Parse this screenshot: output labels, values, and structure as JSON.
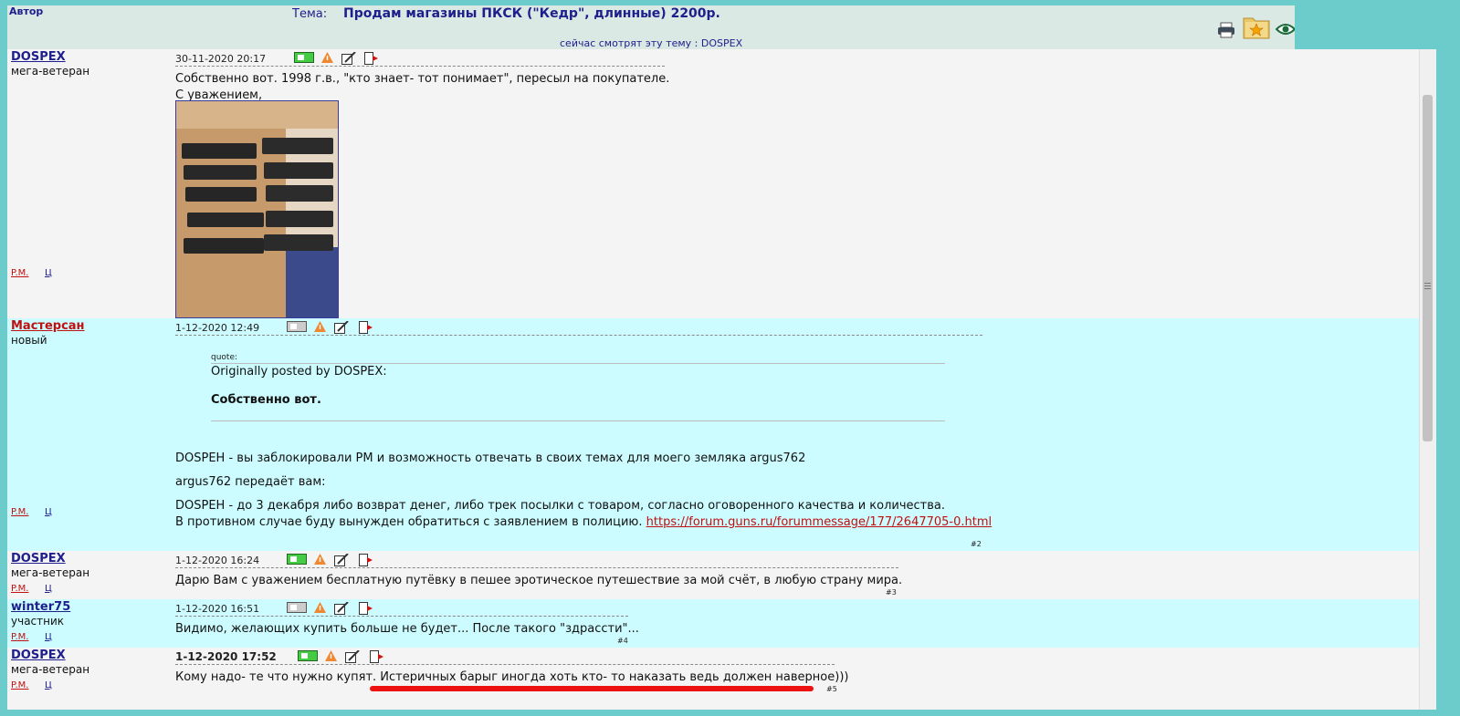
{
  "header": {
    "author_col": "Автор",
    "topic_label": "Тема:",
    "topic_title": "Продам магазины ПКСК (\"Кедр\", длинные) 2200р.",
    "watching_label": "сейчас смотрят эту тему",
    "watching_users": "DOSPEX",
    "icons": [
      "printer-icon",
      "favorite-folder-icon",
      "watch-eye-icon"
    ]
  },
  "posts": [
    {
      "author": "DOSPEX",
      "rank": "мега-ветеран",
      "date": "30-11-2020 20:17",
      "pm_label": "P.M.",
      "c_label": "Ц",
      "lines": [
        "Собственно вот. 1998 г.в., \"кто знает- тот понимает\", пересыл на покупателе.",
        "С уважением,"
      ],
      "has_photo": true,
      "number": ""
    },
    {
      "author": "Мастерсан",
      "rank": "новый",
      "date": "1-12-2020 12:49",
      "pm_label": "P.M.",
      "c_label": "Ц",
      "quote": {
        "label": "quote:",
        "from": "Originally posted by DOSPEX:",
        "text": "Собственно вот."
      },
      "lines": [
        "DOSPEH - вы заблокировали РМ и возможность отвечать в своих темах для моего земляка argus762",
        "argus762 передаёт вам:",
        "DOSPEH - до 3 декабря либо возврат денег, либо трек посылки с товаром, согласно оговоренного качества и количества.",
        "В противном случае буду вынужден обратиться с заявлением в полицию."
      ],
      "link": "https://forum.guns.ru/forummessage/177/2647705-0.html",
      "number": "#2"
    },
    {
      "author": "DOSPEX",
      "rank": "мега-ветеран",
      "date": "1-12-2020 16:24",
      "pm_label": "P.M.",
      "c_label": "Ц",
      "lines": [
        "Дарю Вам с уважением бесплатную путёвку в пешее эротическое путешествие за мой счёт, в любую страну мира."
      ],
      "number": "#3"
    },
    {
      "author": "winter75",
      "rank": "участник",
      "date": "1-12-2020 16:51",
      "pm_label": "P.M.",
      "c_label": "Ц",
      "lines": [
        "Видимо, желающих купить больше не будет... После такого \"здрасcти\"..."
      ],
      "number": "#4"
    },
    {
      "author": "DOSPEX",
      "rank": "мега-ветеран",
      "date": "1-12-2020 17:52",
      "pm_label": "P.M.",
      "c_label": "Ц",
      "lines": [
        "Кому надо- те что нужно купят. Истеричных барыг иногда хоть кто- то наказать ведь должен наверное)))"
      ],
      "number": "#5"
    }
  ],
  "colors": {
    "post_light": "#f4f4f4",
    "post_cyan": "#ccfcff",
    "author_link": "#1e1e8c",
    "new_user": "#c01010",
    "frame_bg": "#6ccccc"
  }
}
